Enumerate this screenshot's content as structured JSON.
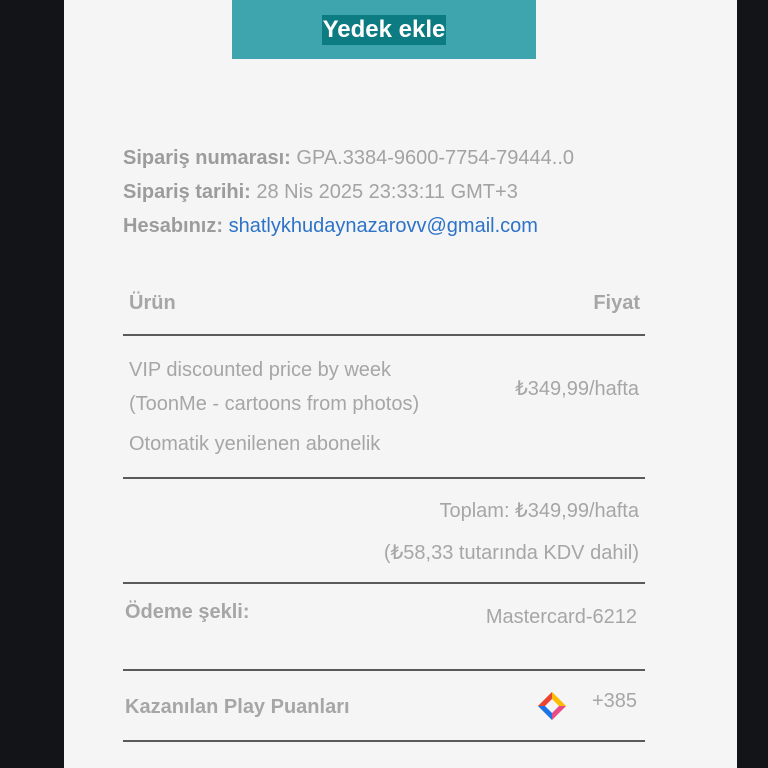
{
  "backup_button": {
    "label": "Yedek ekle"
  },
  "order": {
    "number_label": "Sipariş numarası:",
    "number_value": "GPA.3384-9600-7754-79444..0",
    "date_label": "Sipariş tarihi:",
    "date_value": "28 Nis 2025 23:33:11 GMT+3",
    "account_label": "Hesabınız:",
    "account_value": "shatlykhudaynazarovv@gmail.com"
  },
  "table": {
    "col_product": "Ürün",
    "col_price": "Fiyat",
    "item": {
      "name_line1": "VIP discounted price by week",
      "name_line2": "(ToonMe - cartoons from photos)",
      "subscription": "Otomatik yenilenen abonelik",
      "price": "₺349,99/hafta"
    },
    "total": "Toplam: ₺349,99/hafta",
    "tax": "(₺58,33 tutarında KDV dahil)"
  },
  "payment": {
    "label": "Ödeme şekli:",
    "value": "Mastercard-6212"
  },
  "points": {
    "label": "Kazanılan Play Puanları",
    "value": "+385",
    "icon": "play-points-icon"
  },
  "colors": {
    "accent": "#3ea4ad",
    "link": "#2d73c8"
  }
}
